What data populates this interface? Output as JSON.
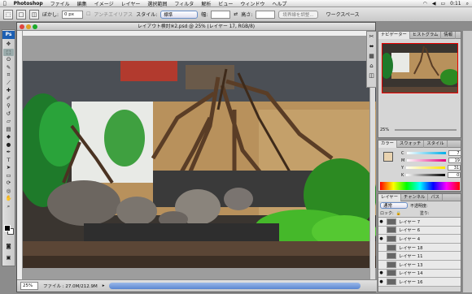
{
  "menubar": {
    "apple": "",
    "app": "Photoshop",
    "items": [
      "ファイル",
      "編集",
      "イメージ",
      "レイヤー",
      "選択範囲",
      "フィルタ",
      "解析",
      "ビュー",
      "ウィンドウ",
      "ヘルプ"
    ],
    "clock": "0:11"
  },
  "options": {
    "feather_label": "ぼかし:",
    "feather_value": "0 px",
    "antialias_label": "アンチエイリアス",
    "style_label": "スタイル:",
    "style_value": "標準",
    "width_label": "幅:",
    "height_label": "高さ:",
    "refine_label": "境界線を調整...",
    "workspace_label": "ワークスペース"
  },
  "document": {
    "title": "レイアウト検討※2.psd @ 25% (レイヤー 17, RGB/8)",
    "zoom": "25%",
    "file_info": "ファイル : 27.0M/212.9M"
  },
  "navigator": {
    "tabs": [
      "ナビゲーター",
      "ヒストグラム",
      "情報"
    ],
    "zoom": "25%"
  },
  "color": {
    "tabs": [
      "カラー",
      "スウォッチ",
      "スタイル"
    ],
    "channels": [
      {
        "label": "C",
        "value": "7",
        "color": "#e6007e"
      },
      {
        "label": "M",
        "value": "19",
        "color": "#ad68a8"
      },
      {
        "label": "Y",
        "value": "31",
        "color": "#d9c36a"
      },
      {
        "label": "K",
        "value": "0",
        "color": "#555555"
      }
    ]
  },
  "layers": {
    "tabs": [
      "レイヤー",
      "チャンネル",
      "パス"
    ],
    "blend_mode": "通常",
    "opacity_label": "不透明度:",
    "lock_label": "ロック:",
    "fill_label": "塗り:",
    "items": [
      "レイヤー 7",
      "レイヤー 6",
      "レイヤー 4",
      "レイヤー 18",
      "レイヤー 11",
      "レイヤー 13",
      "レイヤー 14",
      "レイヤー 16"
    ]
  },
  "colors": {
    "accent": "#3875d7",
    "toolbox_bg": "#d0d0d0"
  }
}
